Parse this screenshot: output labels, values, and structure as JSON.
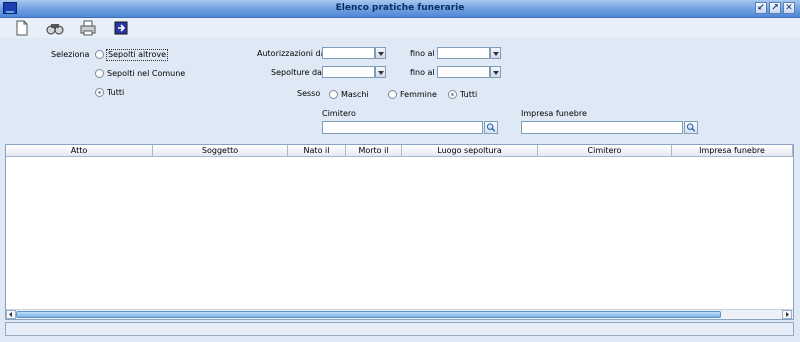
{
  "window": {
    "title": "Elenco pratiche funerarie"
  },
  "filters": {
    "seleziona_label": "Seleziona",
    "options": [
      "Sepolti altrove",
      "Sepolti nel Comune",
      "Tutti"
    ],
    "autorizzazioni_label": "Autorizzazioni dal",
    "sepolture_label": "Sepolture dal",
    "fino_al_label": "fino al",
    "sesso_label": "Sesso",
    "sesso_options": [
      "Maschi",
      "Femmine",
      "Tutti"
    ],
    "cimitero_label": "Cimitero",
    "impresa_label": "Impresa funebre"
  },
  "table": {
    "columns": [
      "Atto",
      "Soggetto",
      "Nato il",
      "Morto il",
      "Luogo sepoltura",
      "Cimitero",
      "Impresa funebre"
    ]
  }
}
